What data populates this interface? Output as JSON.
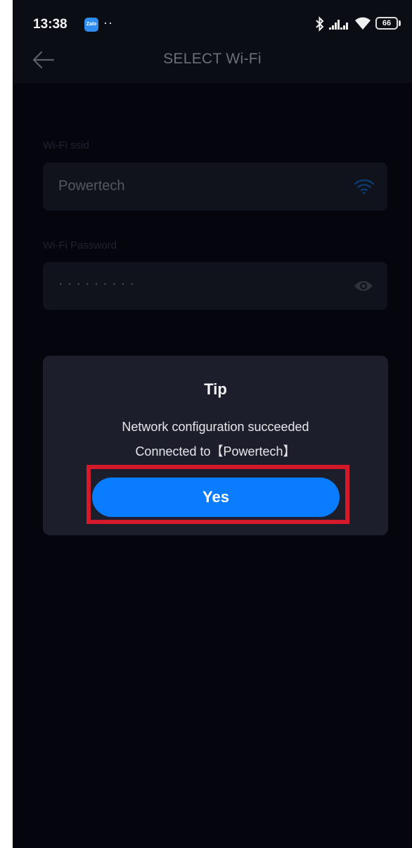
{
  "status_bar": {
    "time": "13:38",
    "notif_app_label": "Zalo",
    "notif_more": "··",
    "battery": "66"
  },
  "header": {
    "title": "SELECT Wi-Fi"
  },
  "form": {
    "ssid_label": "Wi-Fi ssid",
    "ssid_value": "Powertech",
    "password_label": "Wi-Fi Password",
    "password_value": "·········"
  },
  "dialog": {
    "title": "Tip",
    "message_line1": "Network configuration succeeded",
    "message_line2": "Connected to【Powertech】",
    "confirm_label": "Yes"
  },
  "colors": {
    "accent": "#0a7cff",
    "highlight": "#d41a2a",
    "dialog_bg": "#1c1f2b",
    "screen_bg": "#05060d"
  },
  "icons": [
    "bluetooth-icon",
    "signal-icon",
    "wifi-status-icon",
    "battery-icon",
    "back-arrow-icon",
    "wifi-icon",
    "eye-icon"
  ]
}
